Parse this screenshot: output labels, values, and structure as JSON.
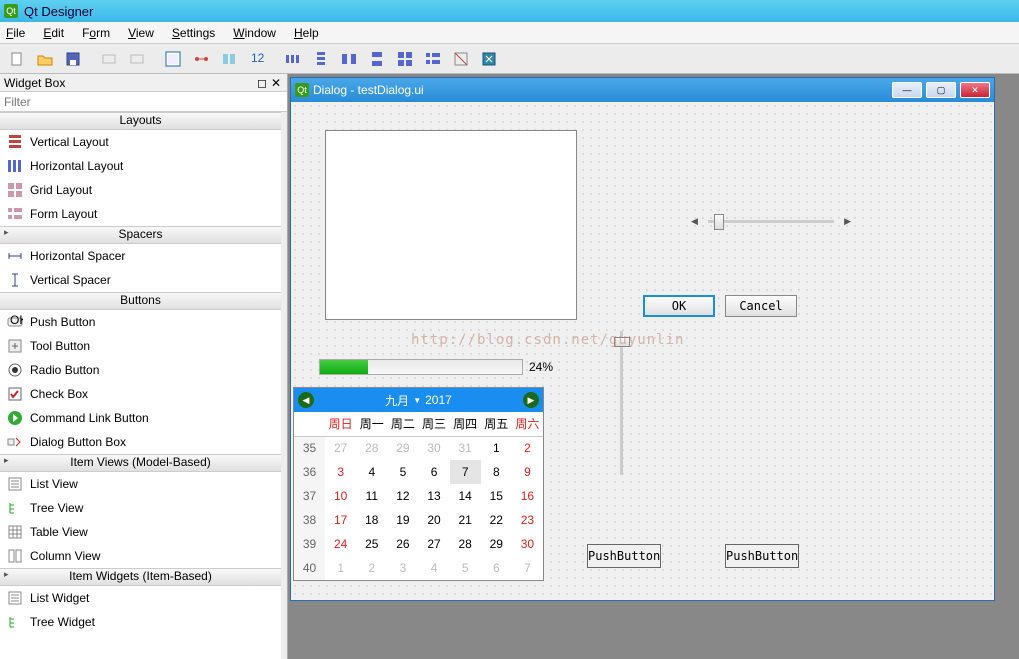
{
  "app": {
    "title": "Qt Designer"
  },
  "menu": {
    "file": "File",
    "edit": "Edit",
    "form": "Form",
    "view": "View",
    "settings": "Settings",
    "window": "Window",
    "help": "Help"
  },
  "widgetbox": {
    "title": "Widget Box",
    "filter_placeholder": "Filter",
    "cats": {
      "layouts": "Layouts",
      "spacers": "Spacers",
      "buttons": "Buttons",
      "itemviews": "Item Views (Model-Based)",
      "itemwidgets": "Item Widgets (Item-Based)"
    },
    "items": {
      "vlayout": "Vertical Layout",
      "hlayout": "Horizontal Layout",
      "gridlayout": "Grid Layout",
      "formlayout": "Form Layout",
      "hspacer": "Horizontal Spacer",
      "vspacer": "Vertical Spacer",
      "pushbutton": "Push Button",
      "toolbutton": "Tool Button",
      "radiobutton": "Radio Button",
      "checkbox": "Check Box",
      "cmdlink": "Command Link Button",
      "dbuttonbox": "Dialog Button Box",
      "listview": "List View",
      "treeview": "Tree View",
      "tableview": "Table View",
      "columnview": "Column View",
      "listwidget": "List Widget",
      "treewidget": "Tree Widget"
    }
  },
  "dialog": {
    "title": "Dialog - testDialog.ui",
    "progress_label": "24%",
    "progress_value": 24,
    "ok": "OK",
    "cancel": "Cancel",
    "pushbtn": "PushButton"
  },
  "calendar": {
    "month": "九月",
    "year": "2017",
    "weekdays": [
      "周日",
      "周一",
      "周二",
      "周三",
      "周四",
      "周五",
      "周六"
    ],
    "weeks": [
      {
        "num": "35",
        "days": [
          "27",
          "28",
          "29",
          "30",
          "31",
          "1",
          "2"
        ],
        "out": [
          0,
          1,
          2,
          3,
          4
        ],
        "wknd": [
          6
        ]
      },
      {
        "num": "36",
        "days": [
          "3",
          "4",
          "5",
          "6",
          "7",
          "8",
          "9"
        ],
        "wknd": [
          0,
          6
        ],
        "sel": 4
      },
      {
        "num": "37",
        "days": [
          "10",
          "11",
          "12",
          "13",
          "14",
          "15",
          "16"
        ],
        "wknd": [
          0,
          6
        ]
      },
      {
        "num": "38",
        "days": [
          "17",
          "18",
          "19",
          "20",
          "21",
          "22",
          "23"
        ],
        "wknd": [
          0,
          6
        ]
      },
      {
        "num": "39",
        "days": [
          "24",
          "25",
          "26",
          "27",
          "28",
          "29",
          "30"
        ],
        "wknd": [
          0,
          6
        ]
      },
      {
        "num": "40",
        "days": [
          "1",
          "2",
          "3",
          "4",
          "5",
          "6",
          "7"
        ],
        "out": [
          0,
          1,
          2,
          3,
          4,
          5,
          6
        ]
      }
    ]
  },
  "watermark": "http://blog.csdn.net/guyunlin"
}
